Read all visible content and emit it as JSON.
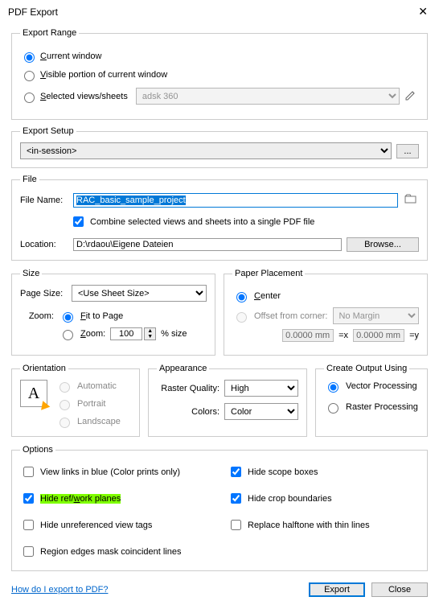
{
  "title": "PDF Export",
  "exportRange": {
    "legend": "Export Range",
    "opt1": "Current window",
    "opt2": "Visible portion of current window",
    "opt3": "Selected views/sheets",
    "set": "adsk 360"
  },
  "exportSetup": {
    "legend": "Export Setup",
    "value": "<in-session>",
    "more": "..."
  },
  "file": {
    "legend": "File",
    "fileNameLabel": "File Name:",
    "fileName": "RAC_basic_sample_project",
    "combine": "Combine selected views and sheets into a single PDF file",
    "locationLabel": "Location:",
    "location": "D:\\rdaou\\Eigene Dateien",
    "browse": "Browse..."
  },
  "size": {
    "legend": "Size",
    "pageSizeLabel": "Page Size:",
    "pageSize": "<Use Sheet Size>",
    "zoomLabel": "Zoom:",
    "fit": "Fit to Page",
    "zoomOpt": "Zoom:",
    "zoomVal": "100",
    "pctSize": "% size"
  },
  "paper": {
    "legend": "Paper Placement",
    "center": "Center",
    "offset": "Offset from corner:",
    "margin": "No Margin",
    "xv": "0.0000 mm",
    "xs": "=x",
    "yv": "0.0000 mm",
    "ys": "=y"
  },
  "orientation": {
    "legend": "Orientation",
    "auto": "Automatic",
    "portrait": "Portrait",
    "landscape": "Landscape",
    "glyph": "A"
  },
  "appearance": {
    "legend": "Appearance",
    "rasterLabel": "Raster Quality:",
    "raster": "High",
    "colorsLabel": "Colors:",
    "colors": "Color"
  },
  "output": {
    "legend": "Create Output Using",
    "vector": "Vector Processing",
    "raster": "Raster Processing"
  },
  "options": {
    "legend": "Options",
    "o1": "View links in blue (Color prints only)",
    "o2": "Hide scope boxes",
    "o3": "Hide ref/work planes",
    "o4": "Hide crop boundaries",
    "o5": "Hide unreferenced view tags",
    "o6": "Replace halftone with thin lines",
    "o7": "Region edges mask coincident lines"
  },
  "helpLink": "How do I export to PDF?",
  "buttons": {
    "export": "Export",
    "close": "Close"
  }
}
